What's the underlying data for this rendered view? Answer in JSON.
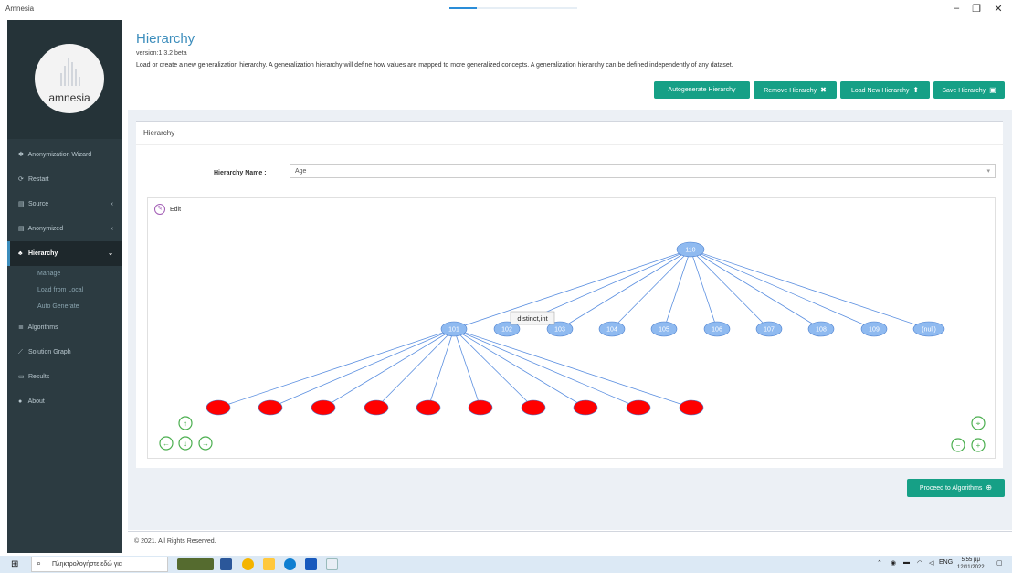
{
  "window": {
    "title": "Amnesia"
  },
  "logo": {
    "text": "amnesia"
  },
  "sidebar": {
    "items": [
      {
        "label": "Anonymization Wizard",
        "icon": "magic-icon",
        "glyph": "✱"
      },
      {
        "label": "Restart",
        "icon": "refresh-icon",
        "glyph": "⟳"
      },
      {
        "label": "Source",
        "icon": "table-icon",
        "glyph": "▤",
        "chevron": "‹"
      },
      {
        "label": "Anonymized",
        "icon": "table-icon",
        "glyph": "▤",
        "chevron": "‹"
      },
      {
        "label": "Hierarchy",
        "icon": "sitemap-icon",
        "glyph": "♣",
        "chevron": "⌄"
      },
      {
        "label": "Algorithms",
        "icon": "bars-icon",
        "glyph": "≣"
      },
      {
        "label": "Solution Graph",
        "icon": "line-chart-icon",
        "glyph": "⟋"
      },
      {
        "label": "Results",
        "icon": "monitor-icon",
        "glyph": "▭"
      },
      {
        "label": "About",
        "icon": "info-icon",
        "glyph": "●"
      }
    ],
    "sub_items": [
      "Manage",
      "Load from Local",
      "Auto Generate"
    ]
  },
  "header": {
    "title": "Hierarchy",
    "version": "version:1.3.2 beta",
    "description": "Load or create a new generalization hierarchy. A generalization hierarchy will define how values are mapped to more generalized concepts. A generalization hierarchy can be defined independently of any dataset."
  },
  "buttons": {
    "autogenerate": "Autogenerate Hierarchy",
    "remove": "Remove Hierarchy",
    "remove_icon": "✖",
    "load_new": "Load New Hierarchy",
    "load_icon": "⬆",
    "save": "Save Hierarchy",
    "save_icon": "▣",
    "proceed": "Proceed to Algorithms",
    "proceed_icon": "⊕",
    "accent_color": "#16a086"
  },
  "panel": {
    "heading": "Hierarchy",
    "hierarchy_name_label": "Hierarchy Name :",
    "hierarchy_name_value": "Age",
    "edit_label": "Edit"
  },
  "tree": {
    "root": "110",
    "level1": [
      "101",
      "102",
      "103",
      "104",
      "105",
      "106",
      "107",
      "108",
      "109",
      "(null)"
    ],
    "leaf_count": 10,
    "tooltip": "distinct,int",
    "node_color": "#8fbaf0",
    "leaf_color": "#ff0000",
    "edge_color": "#5b8fe0"
  },
  "footer": {
    "text": "© 2021. All Rights Reserved."
  },
  "taskbar": {
    "search_placeholder": "Πληκτρολογήστε εδώ για",
    "language": "ENG",
    "time": "5:55 μμ",
    "date": "12/11/2022"
  }
}
